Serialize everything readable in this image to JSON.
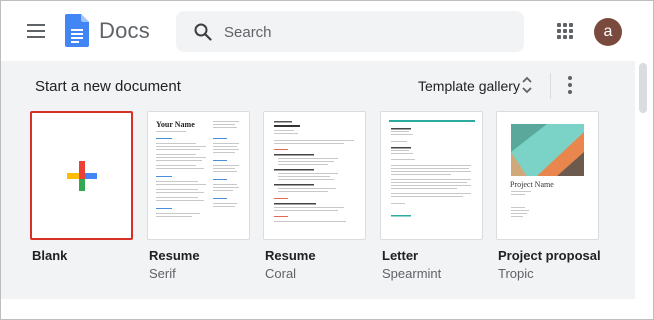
{
  "header": {
    "app_name": "Docs",
    "search_placeholder": "Search",
    "avatar_letter": "a"
  },
  "templates_section": {
    "title": "Start a new document",
    "gallery_label": "Template gallery"
  },
  "templates": [
    {
      "name": "Blank",
      "subtitle": ""
    },
    {
      "name": "Resume",
      "subtitle": "Serif",
      "thumb_heading": "Your Name"
    },
    {
      "name": "Resume",
      "subtitle": "Coral"
    },
    {
      "name": "Letter",
      "subtitle": "Spearmint"
    },
    {
      "name": "Project proposal",
      "subtitle": "Tropic",
      "thumb_heading": "Project Name"
    }
  ],
  "colors": {
    "accent_red": "#d93025",
    "docs_blue": "#4285f4",
    "avatar_bg": "#7b4a3f"
  }
}
